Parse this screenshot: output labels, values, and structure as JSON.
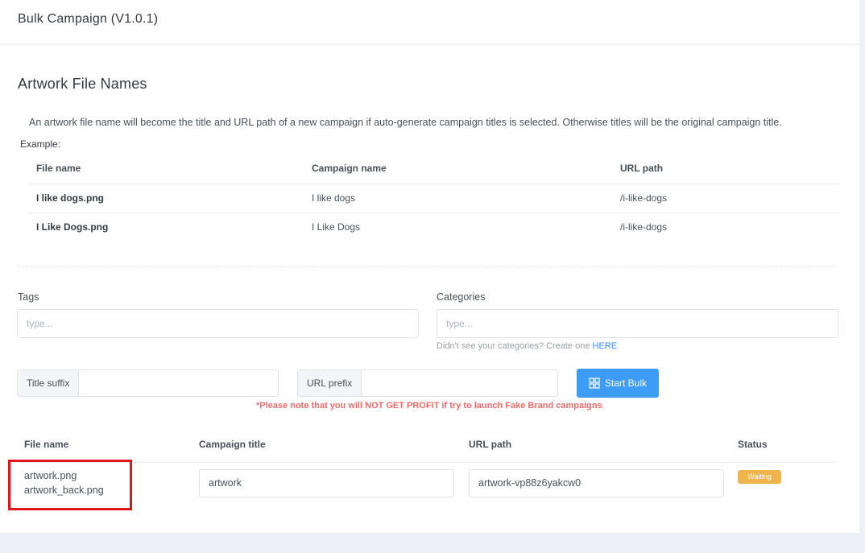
{
  "header": {
    "title": "Bulk Campaign (V1.0.1)"
  },
  "section": {
    "title": "Artwork File Names",
    "description": "An artwork file name will become the title and URL path of a new campaign if auto-generate campaign titles is selected. Otherwise titles will be the original campaign title.",
    "example_label": "Example:"
  },
  "example_table": {
    "headers": [
      "File name",
      "Campaign name",
      "URL path"
    ],
    "rows": [
      [
        "I like dogs.png",
        "I like dogs",
        "/i-like-dogs"
      ],
      [
        "I Like Dogs.png",
        "I Like Dogs",
        "/i-like-dogs"
      ]
    ]
  },
  "form": {
    "tags_label": "Tags",
    "tags_placeholder": "type...",
    "categories_label": "Categories",
    "categories_placeholder": "type...",
    "categories_hint": "Didn't see your categories? Create one ",
    "categories_hint_link": "HERE",
    "title_suffix_label": "Title suffix",
    "url_prefix_label": "URL prefix",
    "start_button": "Start Bulk",
    "warning": "*Please note that you will NOT GET PROFIT if try to launch Fake Brand campaigns"
  },
  "files_table": {
    "headers": [
      "File name",
      "Campaign title",
      "URL path",
      "Status"
    ],
    "rows": [
      {
        "files": [
          "artwork.png",
          "artwork_back.png"
        ],
        "campaign_title": "artwork",
        "url_path": "artwork-vp88z6yakcw0",
        "status": "Waiting"
      }
    ]
  },
  "colors": {
    "primary": "#3d9cf5",
    "danger": "#f46a6a",
    "warning": "#f1b44c",
    "highlight": "#e3141b"
  },
  "icons": {
    "start_button_icon": "bulk-grid-icon"
  }
}
